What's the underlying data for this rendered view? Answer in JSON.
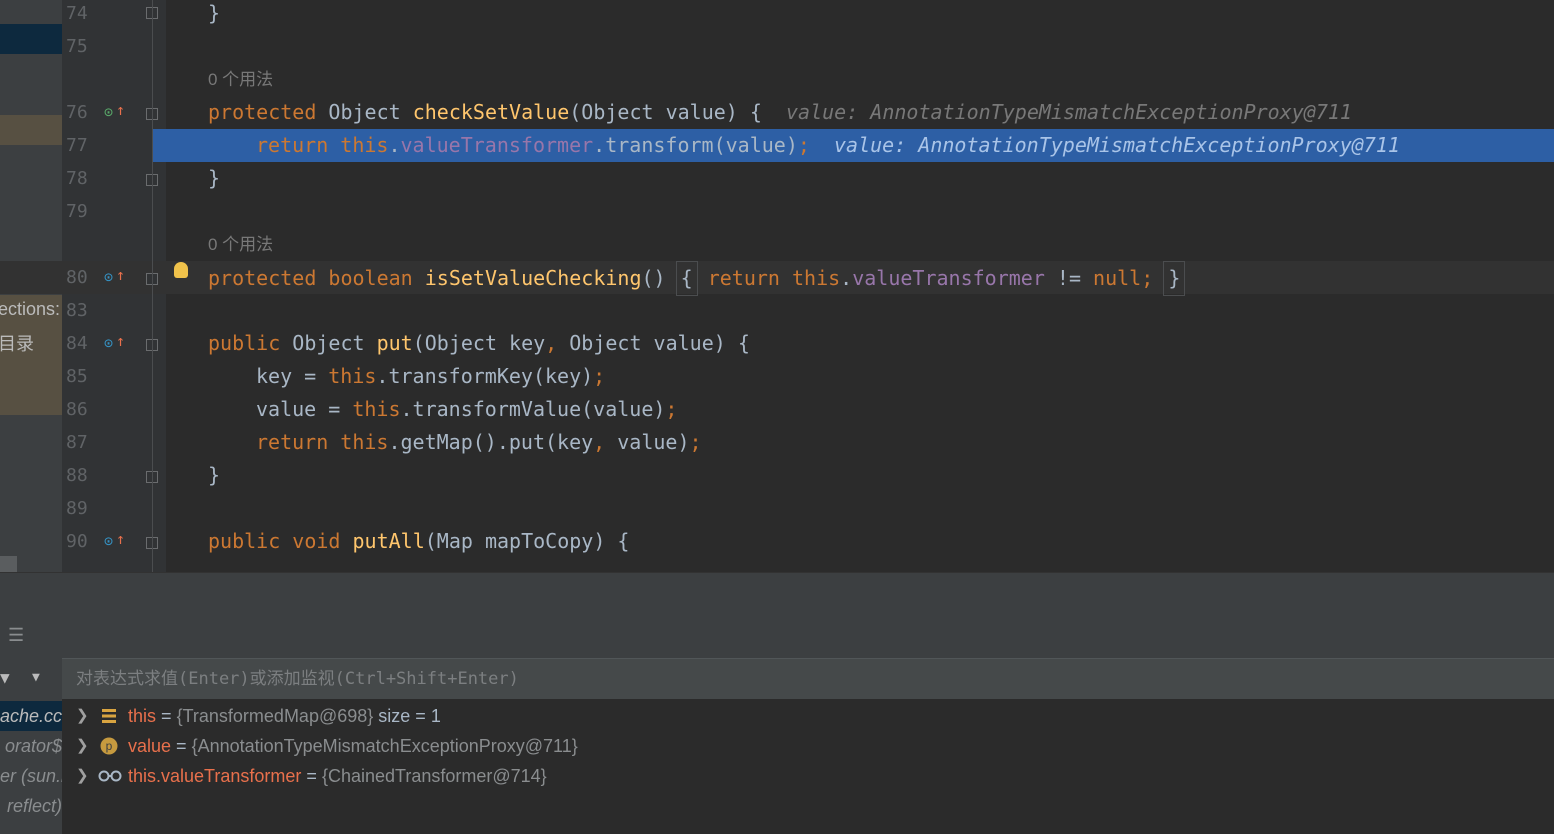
{
  "sidebar": {
    "texts": [
      "ections:",
      "目录"
    ],
    "frames": [
      "ache.cc",
      "orator$",
      "er (sun.r",
      "reflect)"
    ]
  },
  "editor": {
    "lines": [
      {
        "num": "74",
        "code": "}"
      },
      {
        "num": "75",
        "code": ""
      },
      {
        "num": "76",
        "code": "protected Object checkSetValue(Object value) {",
        "hint_before": "0 个用法",
        "inline": "value: AnnotationTypeMismatchExceptionProxy@711"
      },
      {
        "num": "77",
        "code": "return this.valueTransformer.transform(value);",
        "inline": "value: AnnotationTypeMismatchExceptionProxy@711"
      },
      {
        "num": "78",
        "code": "}"
      },
      {
        "num": "79",
        "code": ""
      },
      {
        "num": "80",
        "code": "protected boolean isSetValueChecking() { return this.valueTransformer != null; }",
        "hint_before": "0 个用法"
      },
      {
        "num": "83",
        "code": ""
      },
      {
        "num": "84",
        "code": "public Object put(Object key, Object value) {"
      },
      {
        "num": "85",
        "code": "key = this.transformKey(key);"
      },
      {
        "num": "86",
        "code": "value = this.transformValue(value);"
      },
      {
        "num": "87",
        "code": "return this.getMap().put(key, value);"
      },
      {
        "num": "88",
        "code": "}"
      },
      {
        "num": "89",
        "code": ""
      },
      {
        "num": "90",
        "code": "public void putAll(Map mapToCopy) {"
      }
    ],
    "usages_hint": "0 个用法"
  },
  "debugger": {
    "eval_placeholder": "对表达式求值(Enter)或添加监视(Ctrl+Shift+Enter)",
    "variables": [
      {
        "name": "this",
        "eq": "=",
        "value": "{TransformedMap@698}",
        "extra": "size = 1",
        "icon": "field-list-icon"
      },
      {
        "name": "value",
        "eq": "=",
        "value": "{AnnotationTypeMismatchExceptionProxy@711}",
        "icon": "parameter-icon",
        "icon_letter": "p"
      },
      {
        "name": "this.valueTransformer",
        "eq": "=",
        "value": "{ChainedTransformer@714}",
        "icon": "watch-glasses-icon"
      }
    ]
  },
  "colors": {
    "keyword": "#cc7832",
    "method": "#ffc66d",
    "field": "#9876aa",
    "selection": "#2d5fa5",
    "var_name": "#e8704c"
  }
}
